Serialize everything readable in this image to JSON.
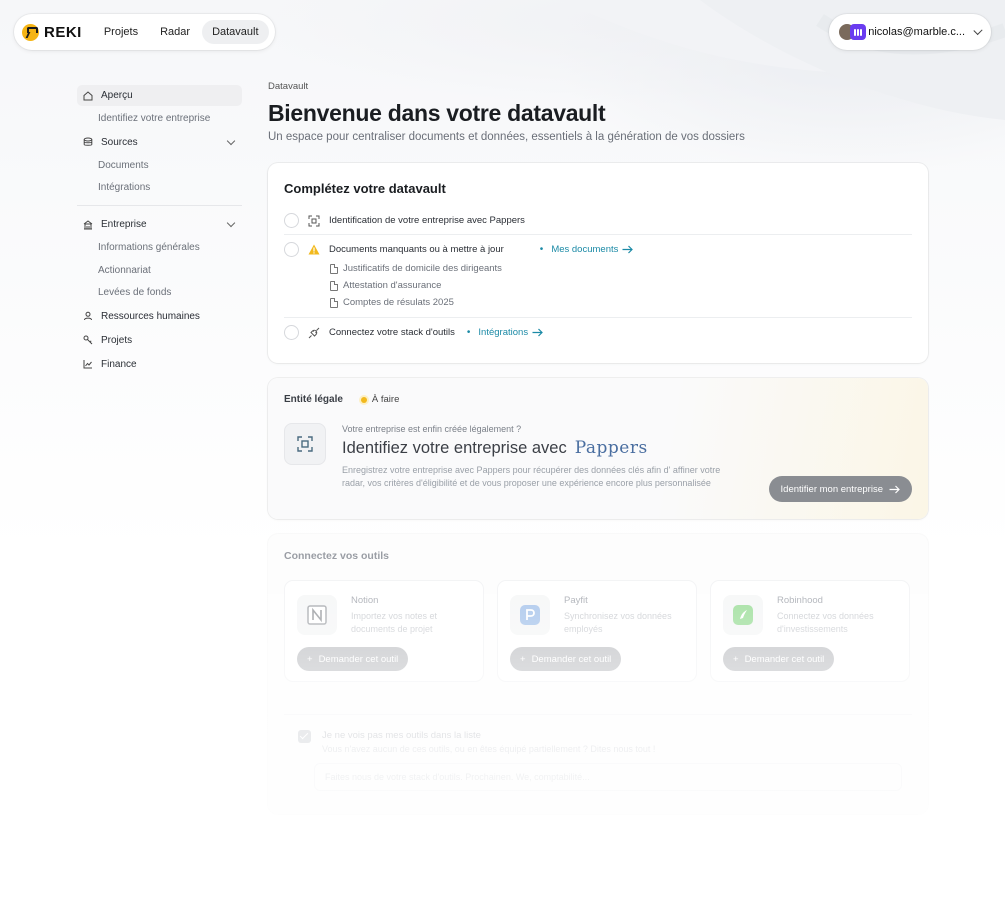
{
  "nav": {
    "logo_text": "REKI",
    "items": [
      {
        "label": "Projets",
        "active": false
      },
      {
        "label": "Radar",
        "active": false
      },
      {
        "label": "Datavault",
        "active": true
      }
    ]
  },
  "user": {
    "email": "nicolas@marble.c..."
  },
  "sidebar": {
    "items": [
      {
        "label": "Aperçu"
      },
      {
        "label": "Identifiez votre entreprise"
      },
      {
        "label": "Sources"
      },
      {
        "label": "Documents"
      },
      {
        "label": "Intégrations"
      },
      {
        "label": "Entreprise"
      },
      {
        "label": "Informations générales"
      },
      {
        "label": "Actionnariat"
      },
      {
        "label": "Levées de fonds"
      },
      {
        "label": "Ressources humaines"
      },
      {
        "label": "Projets"
      },
      {
        "label": "Finance"
      }
    ]
  },
  "main": {
    "breadcrumb": "Datavault",
    "title": "Bienvenue dans votre datavault",
    "subtitle": "Un espace pour centraliser documents et données, essentiels à la génération de vos dossiers"
  },
  "checklist": {
    "title": "Complétez votre datavault",
    "row1": "Identification de votre entreprise avec Pappers",
    "row2": "Documents manquants ou à mettre à jour",
    "row2_link": "Mes documents",
    "docs": [
      "Justificatifs de domicile des dirigeants",
      "Attestation d'assurance",
      "Comptes de résulats 2025"
    ],
    "row3": "Connectez votre stack d'outils",
    "row3_link": "Intégrations",
    "dot": "•"
  },
  "entity": {
    "title": "Entité légale",
    "badge": "À faire",
    "pre": "Votre entreprise est enfin créée légalement ?",
    "headline": "Identifiez votre entreprise avec",
    "brand": "Pappers",
    "desc": "Enregistrez votre entreprise avec Pappers pour récupérer des données clés afin d' affiner votre radar, vos critères d'éligibilité et de vous proposer une expérience encore plus personnalisée",
    "button": "Identifier mon entreprise"
  },
  "tools": {
    "title": "Connectez vos outils",
    "items": [
      {
        "name": "Notion",
        "desc": "Importez vos notes et documents de projet",
        "button": "Demander cet outil"
      },
      {
        "name": "Payfit",
        "desc": "Synchronisez vos données employés",
        "button": "Demander cet outil"
      },
      {
        "name": "Robinhood",
        "desc": "Connectez vos données d'investissements",
        "button": "Demander cet outil"
      }
    ],
    "missing_title": "Je ne vois pas mes outils dans la liste",
    "missing_sub": "Vous n'avez aucun de ces outils, ou en êtes équipé partiellement ? Dites nous tout !",
    "missing_placeholder": "Faites nous de votre stack d'outils. Prochainen. We, comptabilité..."
  },
  "colors": {
    "accent": "#1b8aa6",
    "warning": "#f2b91d",
    "logo": "#f5b414",
    "pappers": "#4a6ea0"
  }
}
